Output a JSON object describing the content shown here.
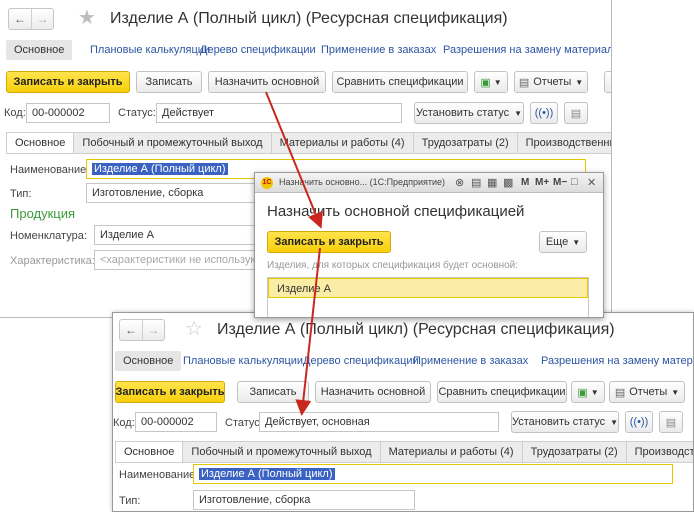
{
  "colors": {
    "accent_yellow": "#f7cf0b",
    "link_blue": "#2c55a3",
    "section_green": "#3a9a3a",
    "arrow_red": "#c8281e",
    "selection_blue": "#3a62c2"
  },
  "form_before": {
    "title": "Изделие А (Полный цикл) (Ресурсная спецификация)",
    "nav_tabs": [
      "Основное",
      "Плановые калькуляции",
      "Дерево спецификации",
      "Применение в заказах",
      "Разрешения на замену материалов"
    ],
    "toolbar": {
      "save_close": "Записать и закрыть",
      "save": "Записать",
      "set_main": "Назначить основной",
      "compare": "Сравнить спецификации",
      "reports": "Отчеты"
    },
    "code_label": "Код:",
    "code_value": "00-000002",
    "status_label": "Статус:",
    "status_value": "Действует",
    "set_status": "Установить статус",
    "tabs": [
      "Основное",
      "Побочный и промежуточный выход",
      "Материалы и работы (4)",
      "Трудозатраты (2)",
      "Производственный процесс"
    ],
    "name_label": "Наименование:",
    "name_value": "Изделие А (Полный цикл)",
    "type_label": "Тип:",
    "type_value": "Изготовление, сборка",
    "product_section": "Продукция",
    "nomenclature_label": "Номенклатура:",
    "nomenclature_value": "Изделие А",
    "characteristic_label": "Характеристика:",
    "characteristic_placeholder": "<характеристики не используются>"
  },
  "dialog": {
    "window_title": "Назначить основно... (1С:Предприятие)",
    "m_buttons": [
      "M",
      "M+",
      "M−"
    ],
    "heading": "Назначить основной спецификацией",
    "save_close": "Записать и закрыть",
    "more": "Еще",
    "hint": "Изделия, для которых спецификация будет основной:",
    "rows": [
      "Изделие А"
    ]
  },
  "form_after": {
    "title": "Изделие А (Полный цикл) (Ресурсная спецификация)",
    "nav_tabs": [
      "Основное",
      "Плановые калькуляции",
      "Дерево спецификации",
      "Применение в заказах",
      "Разрешения на замену материал"
    ],
    "toolbar": {
      "save_close": "Записать и закрыть",
      "save": "Записать",
      "set_main": "Назначить основной",
      "compare": "Сравнить спецификации",
      "reports": "Отчеты"
    },
    "code_label": "Код:",
    "code_value": "00-000002",
    "status_label": "Статус:",
    "status_value": "Действует, основная",
    "set_status": "Установить статус",
    "tabs": [
      "Основное",
      "Побочный и промежуточный выход",
      "Материалы и работы (4)",
      "Трудозатраты (2)",
      "Производственный проце"
    ],
    "name_label": "Наименование:",
    "name_value": "Изделие А (Полный цикл)",
    "type_label": "Тип:",
    "type_value": "Изготовление, сборка"
  }
}
